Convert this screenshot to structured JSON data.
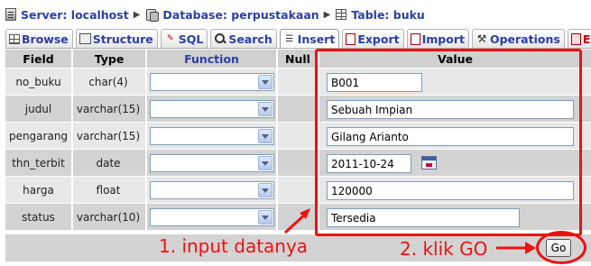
{
  "breadcrumb": {
    "server": "Server: localhost",
    "database": "Database: perpustakaan",
    "table": "Table: buku"
  },
  "tabs": [
    {
      "label": "Browse",
      "icon": "browse-icon"
    },
    {
      "label": "Structure",
      "icon": "structure-icon"
    },
    {
      "label": "SQL",
      "icon": "sql-icon"
    },
    {
      "label": "Search",
      "icon": "search-icon"
    },
    {
      "label": "Insert",
      "icon": "insert-icon",
      "active": true
    },
    {
      "label": "Export",
      "icon": "export-icon"
    },
    {
      "label": "Import",
      "icon": "import-icon"
    },
    {
      "label": "Operations",
      "icon": "operations-icon"
    },
    {
      "label": "Em",
      "icon": "empty-icon"
    }
  ],
  "columns": {
    "field": "Field",
    "type": "Type",
    "function": "Function",
    "null": "Null",
    "value": "Value"
  },
  "rows": [
    {
      "field": "no_buku",
      "type": "char(4)",
      "value": "B001"
    },
    {
      "field": "judul",
      "type": "varchar(15)",
      "value": "Sebuah Impian"
    },
    {
      "field": "pengarang",
      "type": "varchar(15)",
      "value": "Gilang Arianto"
    },
    {
      "field": "thn_terbit",
      "type": "date",
      "value": "2011-10-24"
    },
    {
      "field": "harga",
      "type": "float",
      "value": "120000"
    },
    {
      "field": "status",
      "type": "varchar(10)",
      "value": "Tersedia"
    }
  ],
  "annotations": {
    "step1": "1. input datanya",
    "step2": "2. klik GO"
  },
  "go_label": "Go",
  "colors": {
    "link": "#2b3fa6",
    "annotation": "#ee1111",
    "row_light": "#e8e8e8",
    "row_dark": "#d3d3d3"
  }
}
